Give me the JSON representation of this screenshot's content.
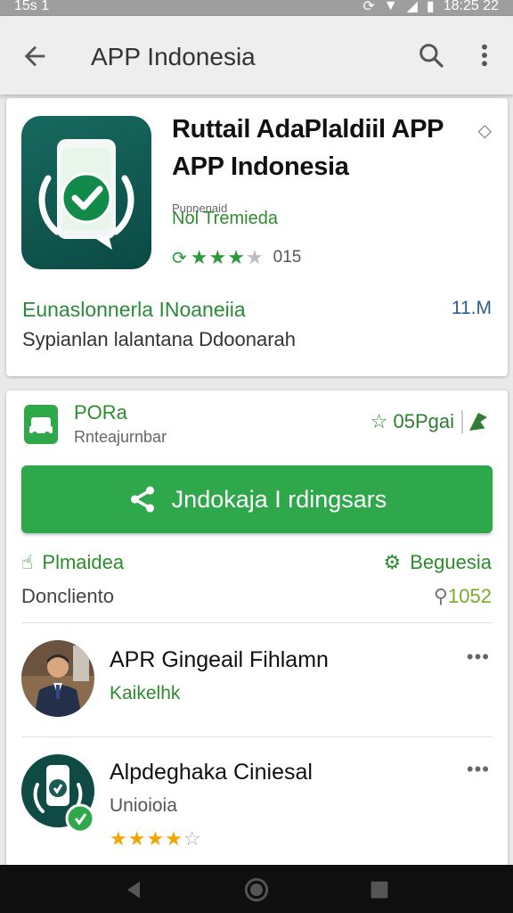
{
  "status_bar": {
    "time": "15s 1",
    "clock": "18:25 22"
  },
  "app_bar": {
    "title": "APP Indonesia"
  },
  "app_card": {
    "title": "Ruttail AdaPlaldiil APP APP Indonesia",
    "developer_small": "Pupnenaid",
    "developer": "Nol Tremieda",
    "rating_count": "015",
    "publisher": "Eunaslonnerla INoaneiia",
    "downloads": "11.M",
    "description": "Sypianlan lalantana Ddoonarah"
  },
  "install_card": {
    "section_title": "PORa",
    "section_subtitle": "Rnteajurnbar",
    "pay_label": "05Pgai",
    "install_label": "Jndokaja I rdingsars",
    "permission_label": "Plmaidea",
    "registration_label": "Beguesia",
    "doc_label": "Doncliento",
    "code_label": "1052"
  },
  "list_items": [
    {
      "name": "APR Gingeail Fihlamn",
      "subtitle": "Kaikelhk"
    },
    {
      "name": "Alpdeghaka Ciniesal",
      "subtitle": "Unioioia"
    }
  ],
  "colors": {
    "accent": "#2ea84a",
    "app_icon": "#0f5a52",
    "status_bar": "#9e9e9e"
  },
  "icons": [
    "back-arrow-icon",
    "search-icon",
    "more-vert-icon",
    "share-icon",
    "lightning-icon",
    "flag-icon",
    "gear-icon"
  ]
}
